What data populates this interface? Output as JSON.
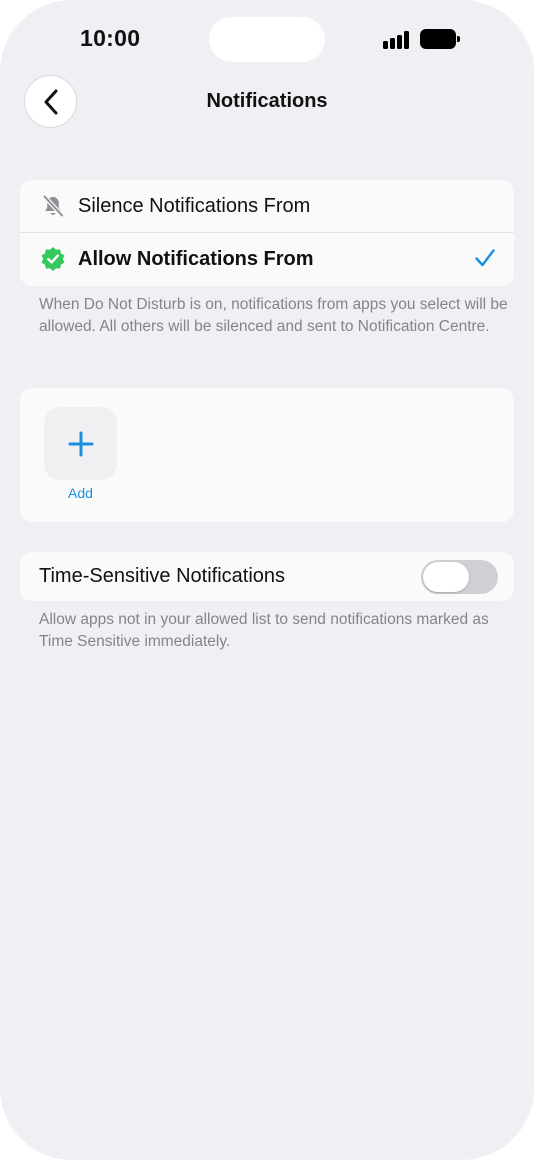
{
  "status_bar": {
    "time": "10:00"
  },
  "nav": {
    "title": "Notifications",
    "back_icon": "chevron-left-icon"
  },
  "modes": {
    "options": [
      {
        "label": "Silence Notifications From",
        "icon": "bell-slash-icon",
        "selected": false
      },
      {
        "label": "Allow Notifications From",
        "icon": "verified-badge-icon",
        "selected": true
      }
    ],
    "footnote": "When Do Not Disturb is on, notifications from apps you select will be allowed. All others will be silenced and sent to Notification Centre."
  },
  "apps": {
    "add_label": "Add",
    "add_icon": "plus-icon"
  },
  "time_sensitive": {
    "label": "Time-Sensitive Notifications",
    "enabled": false,
    "footnote": "Allow apps not in your allowed list to send notifications marked as Time Sensitive immediately."
  },
  "colors": {
    "accent": "#1a8fe0",
    "badge_green": "#34c759",
    "background": "#efeff4"
  }
}
